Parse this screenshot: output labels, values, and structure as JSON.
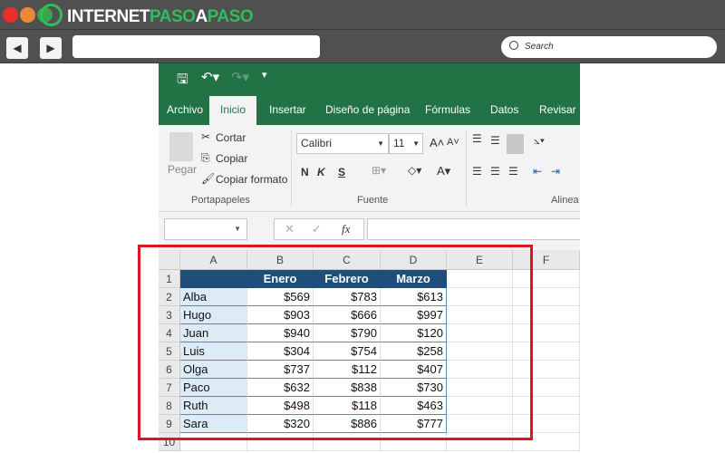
{
  "browser": {
    "logo_text_1": "INTERNET",
    "logo_text_2": "PASO",
    "logo_text_3": "A",
    "logo_text_4": "PASO",
    "search_placeholder": "Search",
    "back": "◀",
    "forward": "▶"
  },
  "excel": {
    "tabs": [
      "Archivo",
      "Inicio",
      "Insertar",
      "Diseño de página",
      "Fórmulas",
      "Datos",
      "Revisar"
    ],
    "clipboard": {
      "paste": "Pegar",
      "cut": "Cortar",
      "copy": "Copiar",
      "format_painter": "Copiar formato",
      "group": "Portapapeles"
    },
    "font": {
      "name": "Calibri",
      "size": "11",
      "bold": "N",
      "italic": "K",
      "underline": "S",
      "group": "Fuente"
    },
    "alignment": {
      "group": "Alinea"
    },
    "formula_bar": {
      "fx": "fx",
      "cancel": "✕",
      "enter": "✓",
      "value": ""
    },
    "columns": [
      "A",
      "B",
      "C",
      "D",
      "E",
      "F"
    ],
    "rows": [
      "1",
      "2",
      "3",
      "4",
      "5",
      "6",
      "7",
      "8",
      "9",
      "10"
    ],
    "header": [
      "",
      "Enero",
      "Febrero",
      "Marzo"
    ],
    "data": [
      [
        "Alba",
        "$569",
        "$783",
        "$613"
      ],
      [
        "Hugo",
        "$903",
        "$666",
        "$997"
      ],
      [
        "Juan",
        "$940",
        "$790",
        "$120"
      ],
      [
        "Luis",
        "$304",
        "$754",
        "$258"
      ],
      [
        "Olga",
        "$737",
        "$112",
        "$407"
      ],
      [
        "Paco",
        "$632",
        "$838",
        "$730"
      ],
      [
        "Ruth",
        "$498",
        "$118",
        "$463"
      ],
      [
        "Sara",
        "$320",
        "$886",
        "$777"
      ]
    ]
  },
  "colors": {
    "excel_green": "#217346",
    "table_header": "#1f4e79",
    "name_fill": "#ddebf7",
    "highlight": "#e0141e"
  }
}
